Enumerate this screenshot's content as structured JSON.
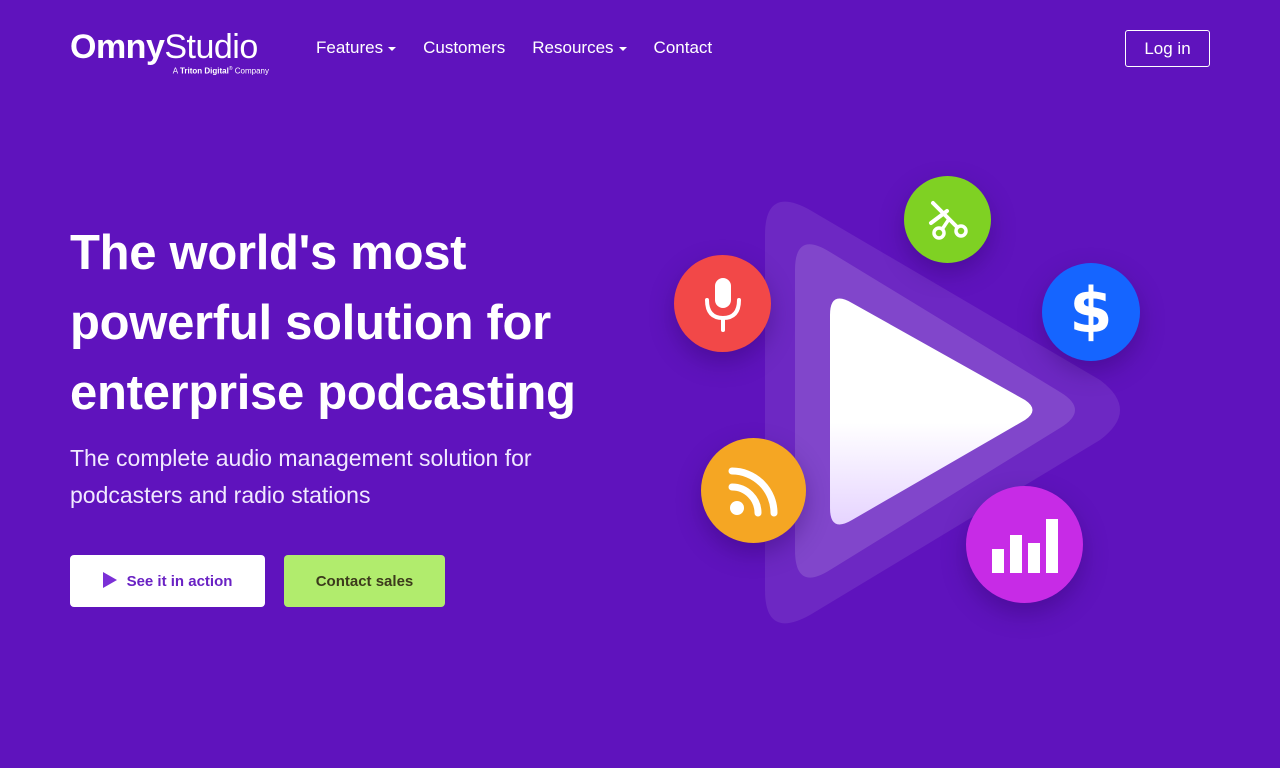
{
  "brand": {
    "name_part1": "Omny",
    "name_part2": "Studio",
    "tagline_prefix": "A",
    "tagline_brand": "Triton Digital",
    "tagline_suffix": "Company",
    "logo_icon": "omny-logo-icon"
  },
  "nav": {
    "items": [
      {
        "label": "Features",
        "has_dropdown": true
      },
      {
        "label": "Customers",
        "has_dropdown": false
      },
      {
        "label": "Resources",
        "has_dropdown": true
      },
      {
        "label": "Contact",
        "has_dropdown": false
      }
    ],
    "login_label": "Log in"
  },
  "hero": {
    "title_line1": "The world's most",
    "title_line2": "powerful solution for",
    "title_line3": "enterprise podcasting",
    "subtitle_line1": "The complete audio management solution for",
    "subtitle_line2": "podcasters and radio stations",
    "cta_primary": "See it in action",
    "cta_secondary": "Contact sales"
  },
  "illustration": {
    "icons": [
      "play-icon",
      "microphone-icon",
      "scissors-icon",
      "dollar-icon",
      "rss-icon",
      "bar-chart-icon"
    ],
    "colors": {
      "microphone": "#f24848",
      "scissors": "#7fd123",
      "dollar": "#1565ff",
      "rss": "#f5a623",
      "chart": "#c72be6",
      "background": "#5f13bd"
    }
  }
}
